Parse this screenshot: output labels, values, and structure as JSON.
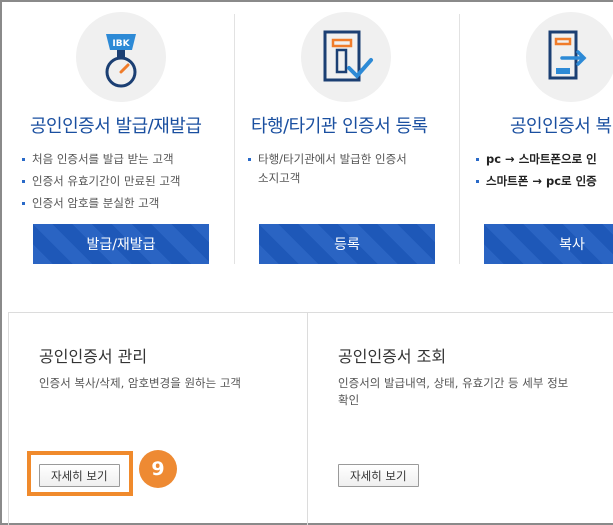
{
  "cards": [
    {
      "icon": "ibk-certificate-badge-icon",
      "icon_text": "IBK",
      "title": "공인인증서 발급/재발급",
      "bullets": [
        "처음 인증서를 발급 받는 고객",
        "인증서 유효기간이 만료된 고객",
        "인증서 암호를 분실한 고객"
      ],
      "button": "발급/재발급"
    },
    {
      "icon": "certificate-register-check-icon",
      "title": "타행/타기관 인증서 등록",
      "bullets": [
        "타행/타기관에서 발급한 인증서",
        "소지고객"
      ],
      "button": "등록"
    },
    {
      "icon": "certificate-copy-phone-icon",
      "title": "공인인증서 복",
      "bullets": [
        "pc → 스마트폰으로 인",
        "스마트폰 → pc로 인증"
      ],
      "button": "복사"
    }
  ],
  "panels": [
    {
      "title": "공인인증서 관리",
      "desc": "인증서 복사/삭제, 암호변경을 원하는 고객",
      "button": "자세히 보기"
    },
    {
      "title": "공인인증서 조회",
      "desc": "인증서의 발급내역, 상태, 유효기간 등 세부 정보 확인",
      "button": "자세히 보기"
    }
  ],
  "annotation": {
    "step_number": "9",
    "highlight_color": "#f08a2c"
  },
  "colors": {
    "accent": "#1f5cc0",
    "title_blue": "#1a4fa0",
    "badge_orange": "#ee8a33"
  }
}
